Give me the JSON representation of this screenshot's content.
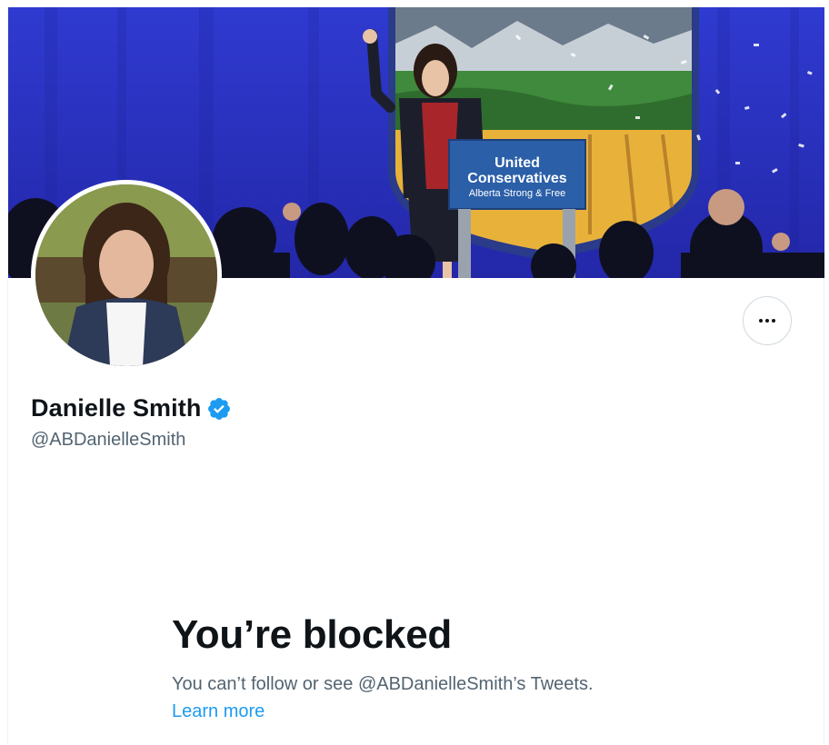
{
  "profile": {
    "display_name": "Danielle Smith",
    "handle": "@ABDanielleSmith",
    "verified": true
  },
  "banner": {
    "podium_line1": "United",
    "podium_line2": "Conservatives",
    "podium_line3": "Alberta Strong & Free"
  },
  "blocked": {
    "title": "You’re blocked",
    "description": "You can’t follow or see @ABDanielleSmith’s Tweets.",
    "learn_more": "Learn more"
  },
  "colors": {
    "accent": "#1d9bf0",
    "text_primary": "#0f1419",
    "text_secondary": "#536471",
    "banner_blue": "#2a2fc4"
  },
  "icons": {
    "verified": "verified-badge-icon",
    "more": "more-icon"
  }
}
